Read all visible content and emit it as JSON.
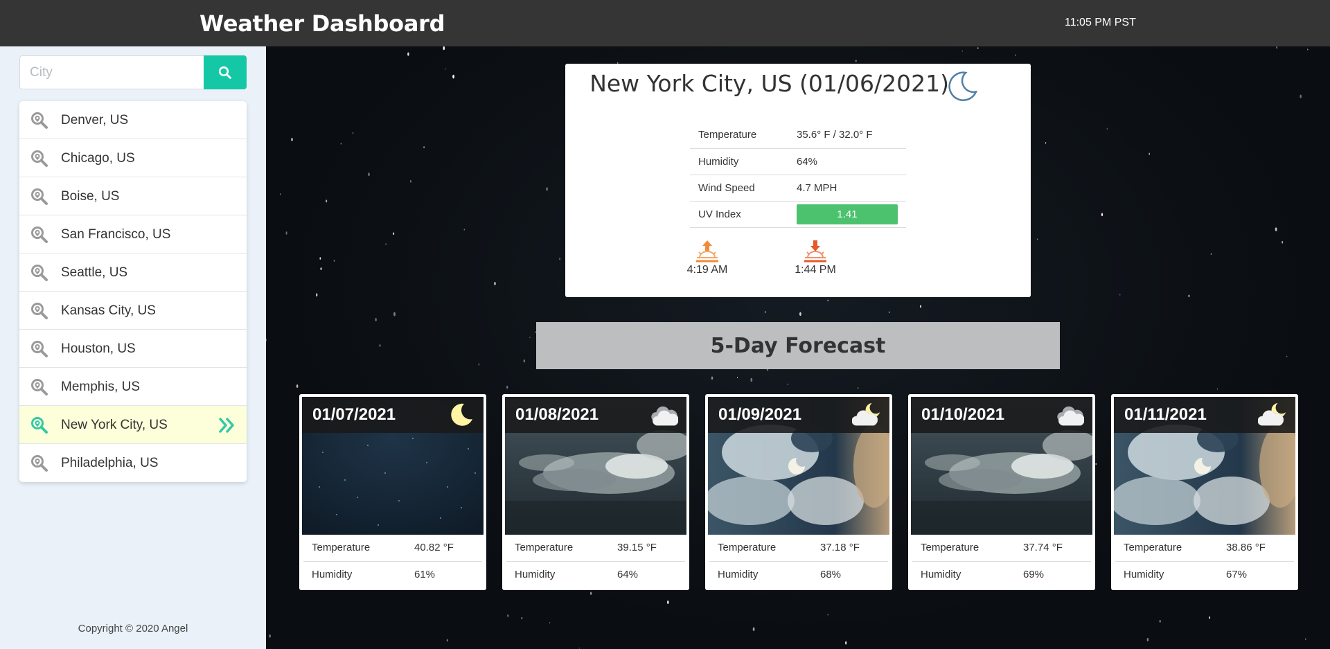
{
  "header": {
    "title": "Weather Dashboard",
    "time": "11:05 PM PST"
  },
  "search": {
    "placeholder": "City",
    "icon": "search-icon"
  },
  "cities": [
    {
      "label": "Denver, US",
      "active": false
    },
    {
      "label": "Chicago, US",
      "active": false
    },
    {
      "label": "Boise, US",
      "active": false
    },
    {
      "label": "San Francisco, US",
      "active": false
    },
    {
      "label": "Seattle, US",
      "active": false
    },
    {
      "label": "Kansas City, US",
      "active": false
    },
    {
      "label": "Houston, US",
      "active": false
    },
    {
      "label": "Memphis, US",
      "active": false
    },
    {
      "label": "New York City, US",
      "active": true
    },
    {
      "label": "Philadelphia, US",
      "active": false
    }
  ],
  "footer": {
    "copyright": "Copyright © 2020 Angel"
  },
  "current": {
    "title": "New York City, US (01/06/2021)",
    "icon": "moon-icon",
    "stats": [
      {
        "label": "Temperature",
        "value": "35.6° F / 32.0° F"
      },
      {
        "label": "Humidity",
        "value": "64%"
      },
      {
        "label": "Wind Speed",
        "value": "4.7 MPH"
      },
      {
        "label": "UV Index",
        "value": "1.41"
      }
    ],
    "uv_color": "#4cc26e",
    "sunrise": "4:19 AM",
    "sunset": "1:44 PM"
  },
  "forecast": {
    "heading": "5-Day Forecast",
    "temp_label": "Temperature",
    "humidity_label": "Humidity",
    "days": [
      {
        "date": "01/07/2021",
        "icon": "moon-icon",
        "scene": "night",
        "temperature": "40.82 °F",
        "humidity": "61%"
      },
      {
        "date": "01/08/2021",
        "icon": "cloud-icon",
        "scene": "clouds",
        "temperature": "39.15 °F",
        "humidity": "64%"
      },
      {
        "date": "01/09/2021",
        "icon": "cloud-moon-icon",
        "scene": "cloudy-moon",
        "temperature": "37.18 °F",
        "humidity": "68%"
      },
      {
        "date": "01/10/2021",
        "icon": "cloud-icon",
        "scene": "clouds",
        "temperature": "37.74 °F",
        "humidity": "69%"
      },
      {
        "date": "01/11/2021",
        "icon": "cloud-moon-icon",
        "scene": "cloudy-moon",
        "temperature": "38.86 °F",
        "humidity": "67%"
      }
    ]
  },
  "colors": {
    "accent": "#14c7a5",
    "topbar": "#353535",
    "sidebar": "#eaf1f8",
    "active_row": "#fcffd9",
    "moon": "#fff4a3"
  }
}
